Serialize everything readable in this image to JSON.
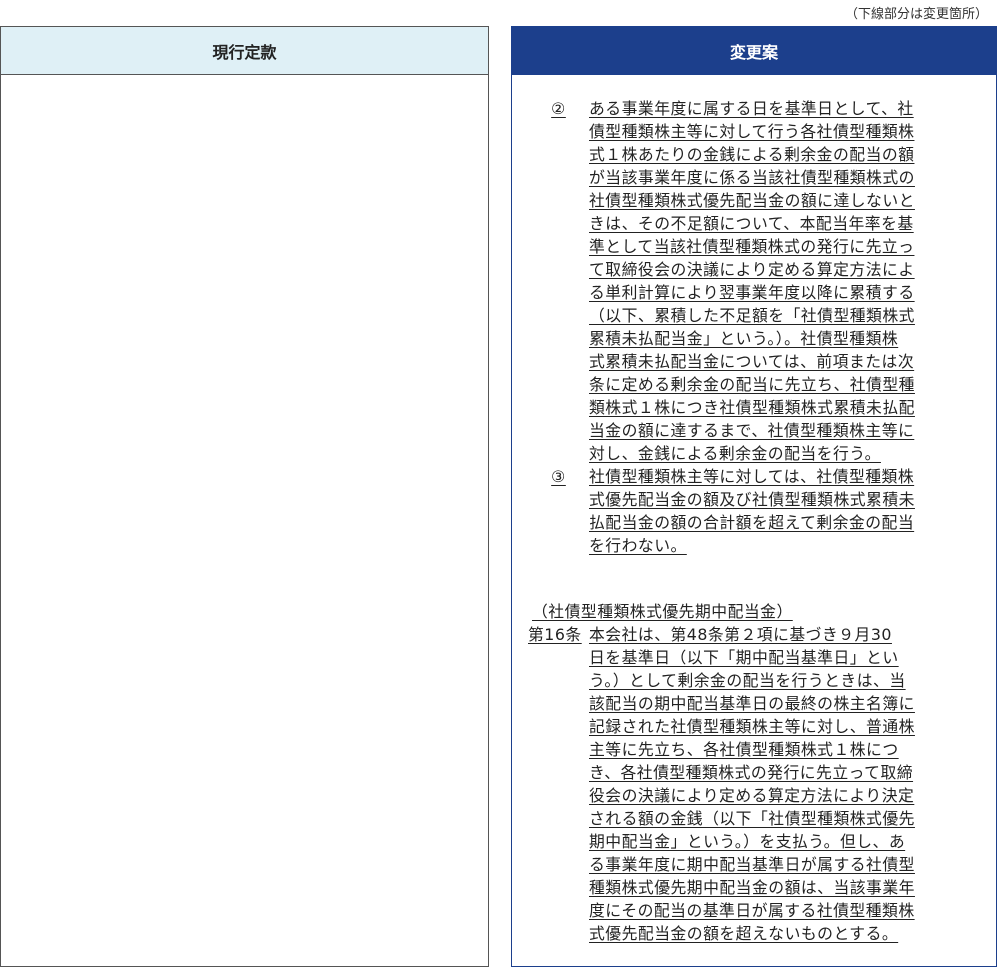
{
  "note": "（下線部分は変更箇所）",
  "columns": {
    "current_label": "現行定款",
    "proposed_label": "変更案"
  },
  "proposed": {
    "p2_num": "②",
    "p2_lines": [
      "ある事業年度に属する日を基準日として、社",
      "債型種類株主等に対して行う各社債型種類株",
      "式１株あたりの金銭による剰余金の配当の額",
      "が当該事業年度に係る当該社債型種類株式の",
      "社債型種類株式優先配当金の額に達しないと",
      "きは、その不足額について、本配当年率を基",
      "準として当該社債型種類株式の発行に先立っ",
      "て取締役会の決議により定める算定方法によ",
      "る単利計算により翌事業年度以降に累積する",
      "（以下、累積した不足額を「社債型種類株式",
      "累積未払配当金」という。）。社債型種類株",
      "式累積未払配当金については、前項または次",
      "条に定める剰余金の配当に先立ち、社債型種",
      "類株式１株につき社債型種類株式累積未払配",
      "当金の額に達するまで、社債型種類株主等に",
      "対し、金銭による剰余金の配当を行う。"
    ],
    "p3_num": "③",
    "p3_lines": [
      "社債型種類株主等に対しては、社債型種類株",
      "式優先配当金の額及び社債型種類株式累積未",
      "払配当金の額の合計額を超えて剰余金の配当",
      "を行わない。"
    ],
    "art16_heading": "（社債型種類株式優先期中配当金）",
    "art16_num": "第16条",
    "art16_lines": [
      "本会社は、第48条第２項に基づき９月30",
      "日を基準日（以下「期中配当基準日」とい",
      "う。）として剰余金の配当を行うときは、当",
      "該配当の期中配当基準日の最終の株主名簿に",
      "記録された社債型種類株主等に対し、普通株",
      "主等に先立ち、各社債型種類株式１株につ",
      "き、各社債型種類株式の発行に先立って取締",
      "役会の決議により定める算定方法により決定",
      "される額の金銭（以下「社債型種類株式優先",
      "期中配当金」という。）を支払う。但し、あ",
      "る事業年度に期中配当基準日が属する社債型",
      "種類株式優先期中配当金の額は、当該事業年",
      "度にその配当の基準日が属する社債型種類株",
      "式優先配当金の額を超えないものとする。"
    ]
  }
}
